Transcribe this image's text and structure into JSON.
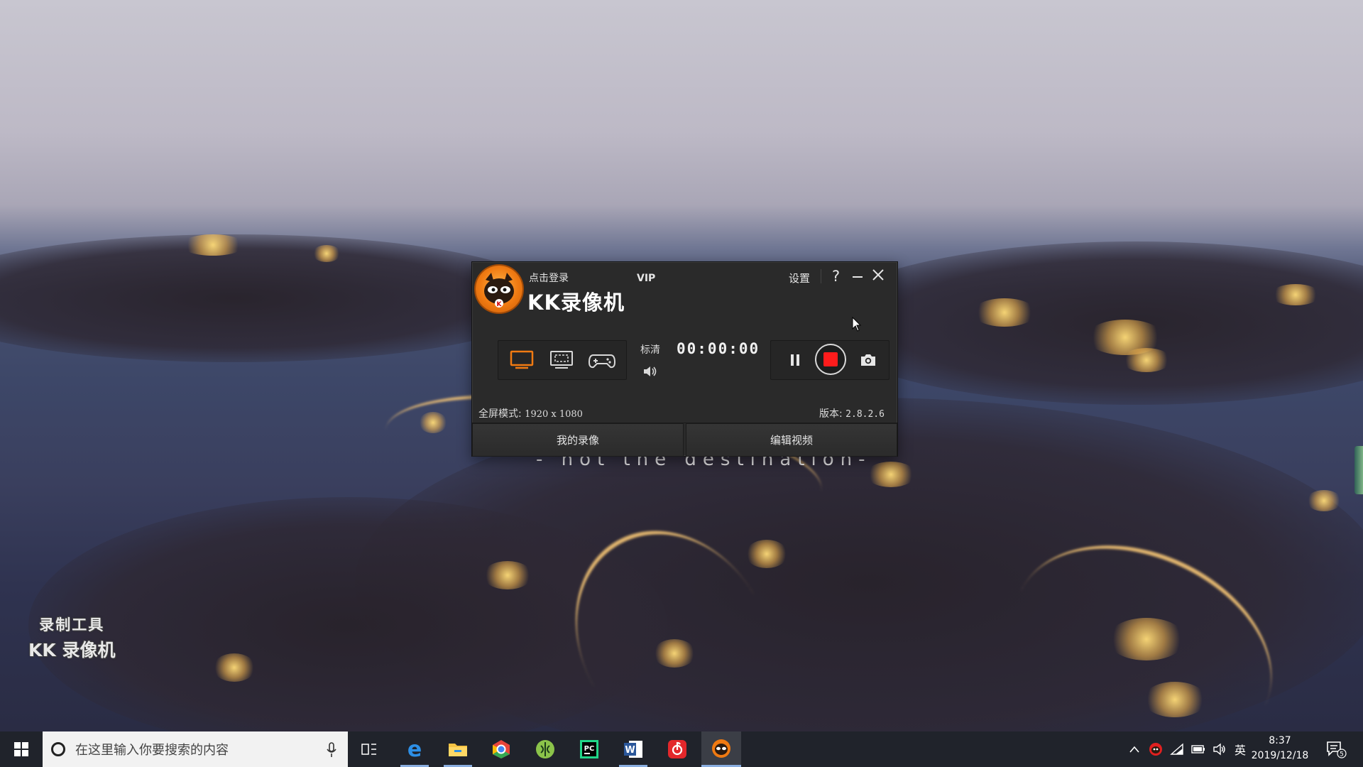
{
  "wallpaper": {
    "caption": "- not the destination-"
  },
  "watermark": {
    "line1": "录制工具",
    "line2": "KK 录像机"
  },
  "kk_window": {
    "login_text": "点击登录",
    "vip_label": "VIP",
    "app_title": "KK录像机",
    "settings_label": "设置",
    "help_label": "?",
    "modes": [
      "fullscreen-mode",
      "region-mode",
      "game-mode"
    ],
    "quality_label": "标清",
    "timer": "00:00:00",
    "mode_info_label": "全屏模式:",
    "mode_info_resolution": "1920 x 1080",
    "version_label": "版本:",
    "version_number": "2.8.2.6",
    "my_recordings_label": "我的录像",
    "edit_video_label": "编辑视频",
    "accent_color": "#f07a12",
    "record_color": "#ff1c1c"
  },
  "taskbar": {
    "search_placeholder": "在这里输入你要搜索的内容",
    "apps": [
      "task-view",
      "edge",
      "file-explorer",
      "chrome-like",
      "green-app",
      "pycharm",
      "word",
      "netease-music",
      "kk-recorder"
    ],
    "tray": {
      "ime_label": "英",
      "time": "8:37",
      "date": "2019/12/18",
      "notification_count": "5"
    }
  }
}
